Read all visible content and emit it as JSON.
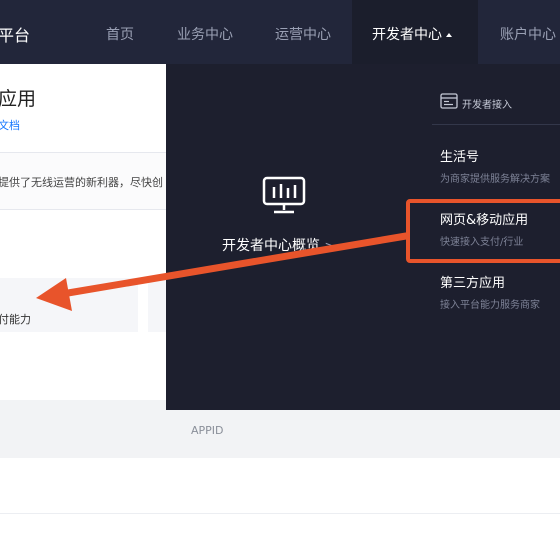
{
  "nav": {
    "brand": "平台",
    "items": [
      "首页",
      "业务中心",
      "运营中心",
      "开发者中心",
      "账户中心"
    ],
    "active_index": 3
  },
  "page": {
    "title": "应用",
    "link": "文档",
    "notice": "提供了无线运营的新利器，尽快创",
    "card_label": "付能力",
    "appid_label": "APPID"
  },
  "dropdown": {
    "overview_label": "开发者中心概览",
    "overview_chevron": ">",
    "dev_access_label": "开发者接入",
    "items": [
      {
        "title": "生活号",
        "desc": "为商家提供服务解决方案"
      },
      {
        "title": "网页&移动应用",
        "desc": "快速接入支付/行业"
      },
      {
        "title": "第三方应用",
        "desc": "接入平台能力服务商家"
      }
    ]
  },
  "colors": {
    "nav_bg": "#22263a",
    "dropdown_bg": "#1d1f2e",
    "annotation": "#e8542b",
    "link": "#1677ff"
  }
}
